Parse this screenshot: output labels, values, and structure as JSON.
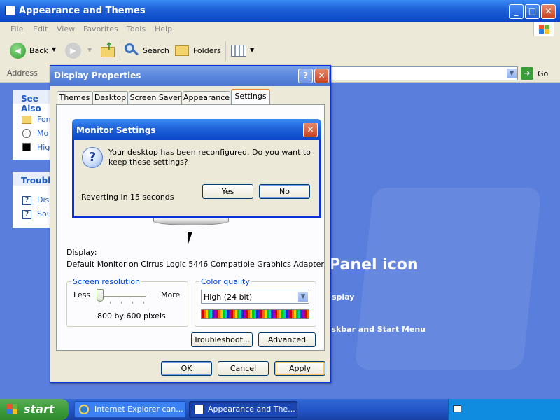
{
  "explorer": {
    "title": "Appearance and Themes",
    "menu": [
      "File",
      "Edit",
      "View",
      "Favorites",
      "Tools",
      "Help"
    ],
    "toolbar": {
      "back": "Back",
      "search": "Search",
      "folders": "Folders"
    },
    "address_label": "Address",
    "go_label": "Go",
    "see_also": {
      "heading": "See Also",
      "items": [
        "Fon",
        "Mo",
        "Hig"
      ]
    },
    "troubleshooters": {
      "heading": "Trouble",
      "items": [
        "Disp",
        "Sou"
      ]
    },
    "content": {
      "heading_fragment": "Panel icon",
      "line1_fragment": "splay",
      "line2_fragment": "askbar and Start Menu"
    }
  },
  "display_properties": {
    "title": "Display Properties",
    "help_glyph": "?",
    "tabs": [
      "Themes",
      "Desktop",
      "Screen Saver",
      "Appearance",
      "Settings"
    ],
    "active_tab": "Settings",
    "display_label": "Display:",
    "display_value": "Default Monitor on Cirrus Logic 5446 Compatible Graphics Adapter",
    "screen_resolution": {
      "label": "Screen resolution",
      "less": "Less",
      "more": "More",
      "value": "800 by 600 pixels",
      "slider_fraction": 0
    },
    "color_quality": {
      "label": "Color quality",
      "value": "High (24 bit)"
    },
    "buttons": {
      "troubleshoot": "Troubleshoot...",
      "advanced": "Advanced",
      "ok": "OK",
      "cancel": "Cancel",
      "apply": "Apply"
    }
  },
  "monitor_settings": {
    "title": "Monitor Settings",
    "message": "Your desktop has been reconfigured.  Do you want to keep these settings?",
    "countdown": "Reverting in 15 seconds",
    "yes": "Yes",
    "no": "No"
  },
  "taskbar": {
    "start": "start",
    "tasks": [
      "Internet Explorer can...",
      "Appearance and The..."
    ]
  },
  "colors": {
    "title_blue": "#0a46c8",
    "content_blue": "#5a7edc",
    "start_green": "#3c9c3a",
    "taskbar_blue": "#2456c8"
  }
}
